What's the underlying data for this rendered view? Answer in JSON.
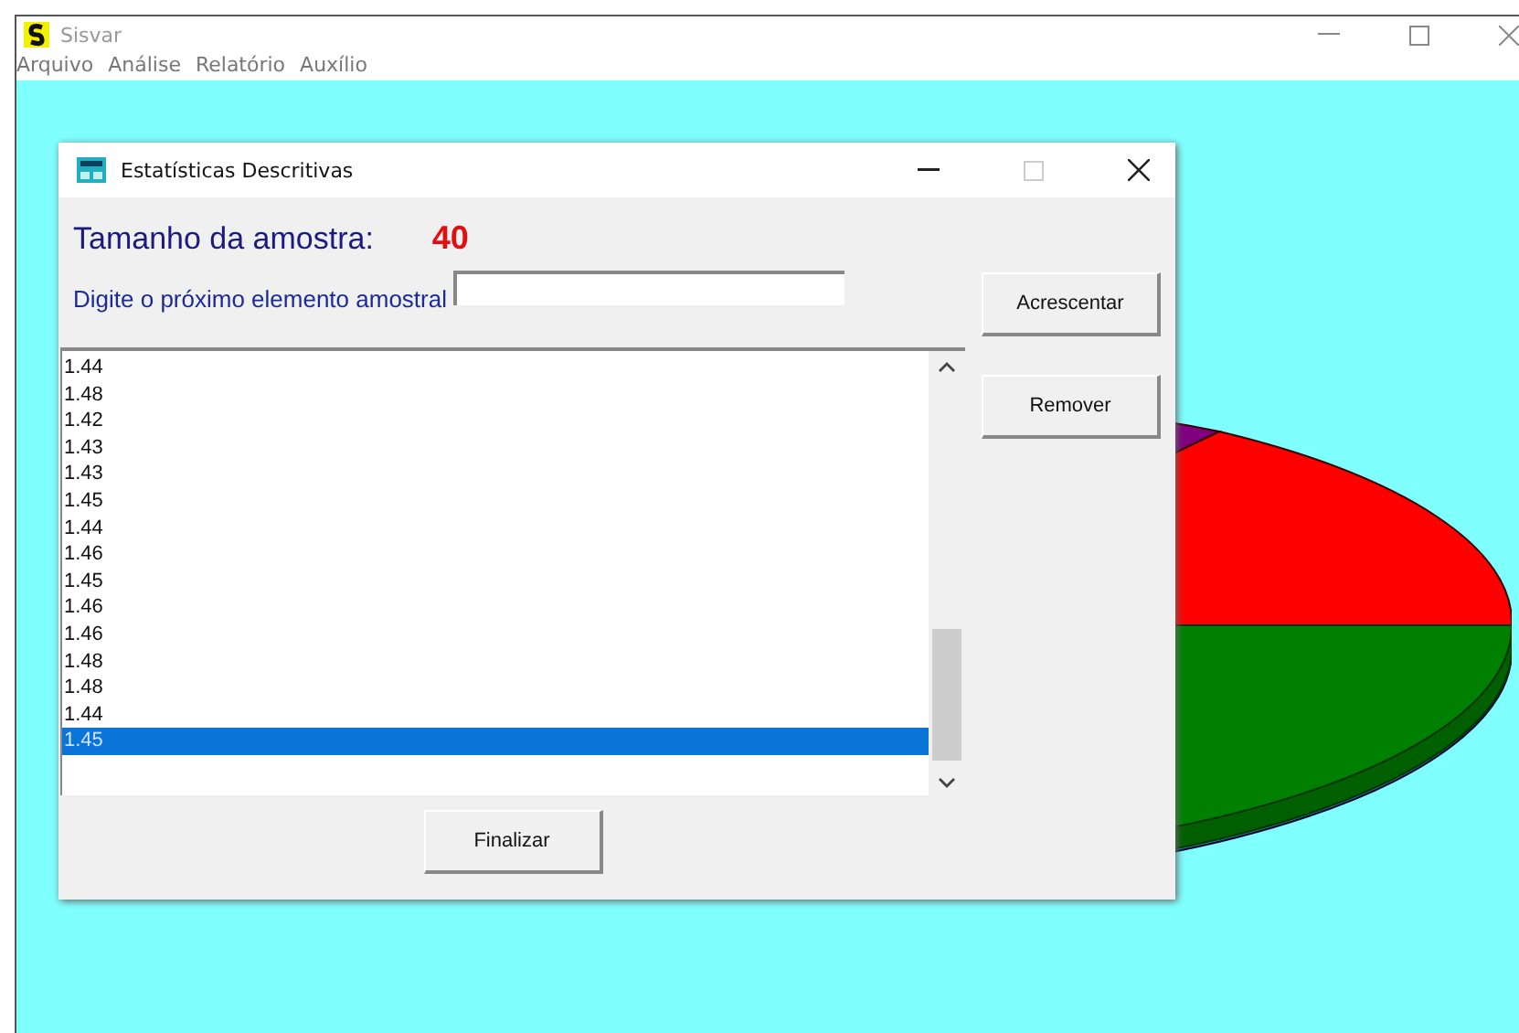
{
  "window": {
    "title": "Sisvar"
  },
  "menu": [
    {
      "label": "Arquivo"
    },
    {
      "label": "Análise"
    },
    {
      "label": "Relatório"
    },
    {
      "label": "Auxílio"
    }
  ],
  "dialog": {
    "title": "Estatísticas Descritivas",
    "sample_size_label": "Tamanho da amostra:",
    "sample_size": "40",
    "input_label": "Digite o próximo elemento amostral",
    "buttons": {
      "add": "Acrescentar",
      "remove": "Remover",
      "finish": "Finalizar"
    },
    "list": [
      {
        "value": "1.44",
        "selected": false
      },
      {
        "value": "1.48",
        "selected": false
      },
      {
        "value": "1.42",
        "selected": false
      },
      {
        "value": "1.43",
        "selected": false
      },
      {
        "value": "1.43",
        "selected": false
      },
      {
        "value": "1.45",
        "selected": false
      },
      {
        "value": "1.44",
        "selected": false
      },
      {
        "value": "1.46",
        "selected": false
      },
      {
        "value": "1.45",
        "selected": false
      },
      {
        "value": "1.46",
        "selected": false
      },
      {
        "value": "1.46",
        "selected": false
      },
      {
        "value": "1.48",
        "selected": false
      },
      {
        "value": "1.48",
        "selected": false
      },
      {
        "value": "1.44",
        "selected": false
      },
      {
        "value": "1.45",
        "selected": true
      }
    ]
  }
}
